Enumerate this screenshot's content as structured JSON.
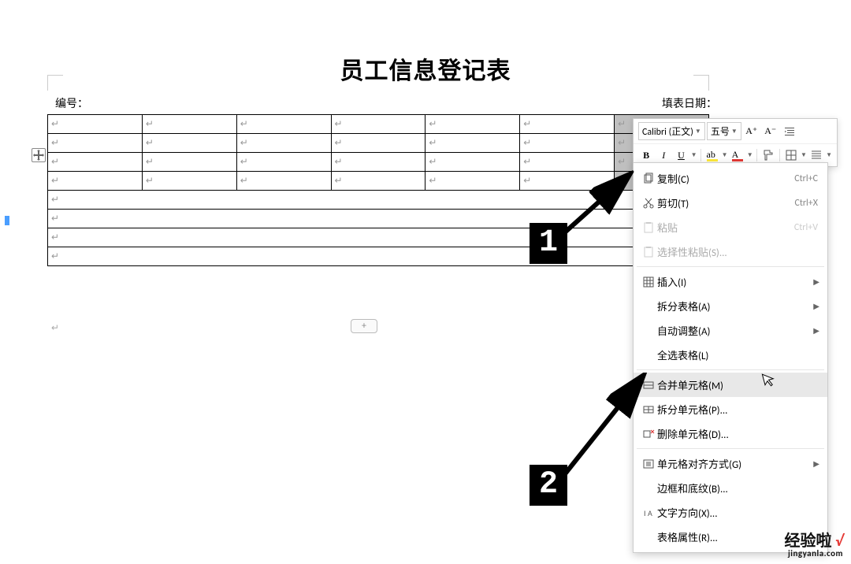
{
  "document": {
    "title": "员工信息登记表",
    "header_left": "编号：",
    "header_right": "填表日期：",
    "cell_mark": "↵"
  },
  "mini_toolbar": {
    "font_name": "Calibri (正文)",
    "font_size": "五号",
    "increase_font": "A⁺",
    "decrease_font": "A⁻",
    "bold": "B",
    "italic": "I",
    "underline": "U",
    "highlight": "ab",
    "font_color": "A"
  },
  "context_menu": {
    "items": [
      {
        "icon": "copy-icon",
        "label": "复制(C)",
        "shortcut": "Ctrl+C",
        "disabled": false
      },
      {
        "icon": "cut-icon",
        "label": "剪切(T)",
        "shortcut": "Ctrl+X",
        "disabled": false
      },
      {
        "icon": "paste-icon",
        "label": "粘贴",
        "shortcut": "Ctrl+V",
        "disabled": true
      },
      {
        "icon": "paste-special-icon",
        "label": "选择性粘贴(S)...",
        "shortcut": "",
        "disabled": true
      },
      {
        "sep": true
      },
      {
        "icon": "insert-icon",
        "label": "插入(I)",
        "shortcut": "",
        "submenu": true
      },
      {
        "icon": "",
        "label": "拆分表格(A)",
        "shortcut": "",
        "submenu": true
      },
      {
        "icon": "",
        "label": "自动调整(A)",
        "shortcut": "",
        "submenu": true
      },
      {
        "icon": "",
        "label": "全选表格(L)",
        "shortcut": ""
      },
      {
        "sep": true
      },
      {
        "icon": "merge-icon",
        "label": "合并单元格(M)",
        "shortcut": "",
        "hover": true
      },
      {
        "icon": "split-icon",
        "label": "拆分单元格(P)...",
        "shortcut": ""
      },
      {
        "icon": "delete-icon",
        "label": "删除单元格(D)...",
        "shortcut": ""
      },
      {
        "sep": true
      },
      {
        "icon": "align-icon",
        "label": "单元格对齐方式(G)",
        "shortcut": "",
        "submenu": true
      },
      {
        "icon": "",
        "label": "边框和底纹(B)...",
        "shortcut": ""
      },
      {
        "icon": "direction-icon",
        "label": "文字方向(X)...",
        "shortcut": ""
      },
      {
        "icon": "",
        "label": "表格属性(R)...",
        "shortcut": ""
      }
    ]
  },
  "annotations": {
    "num1": "1",
    "num2": "2"
  },
  "watermark": {
    "text": "经验啦",
    "check": "√",
    "url": "jingyanla.com"
  }
}
